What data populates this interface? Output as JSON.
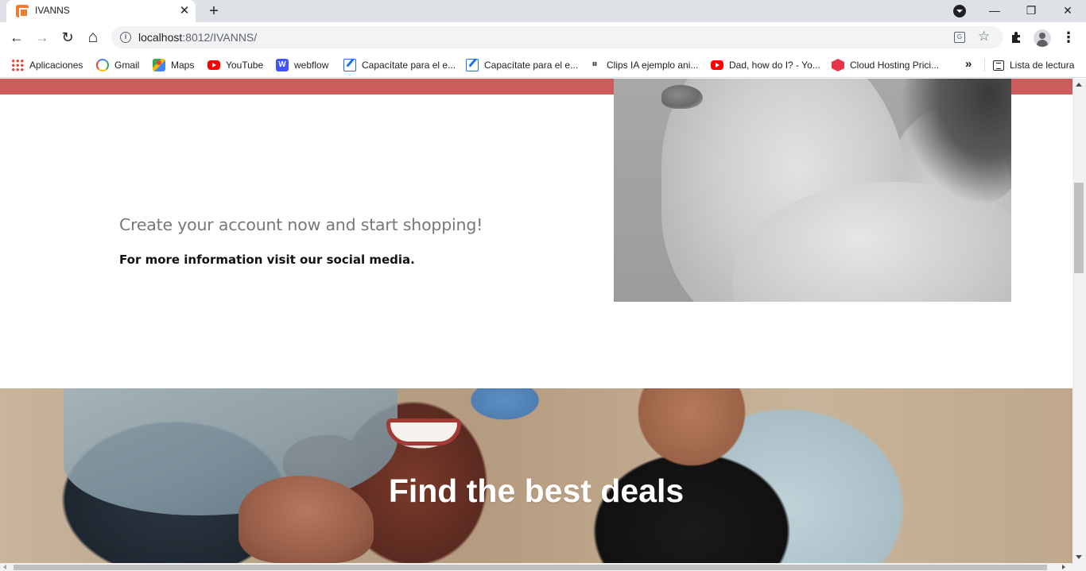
{
  "browser": {
    "tab": {
      "title": "IVANNS",
      "close": "✕"
    },
    "new_tab": "+",
    "window": {
      "minimize": "—",
      "restore": "❐",
      "close": "✕"
    },
    "nav": {
      "back": "←",
      "forward": "→",
      "reload": "↻",
      "home": "⌂"
    },
    "address": {
      "host": "localhost",
      "rest": ":8012/IVANNS/"
    },
    "menu": "⋮",
    "bookmarks": [
      {
        "label": "Aplicaciones",
        "icon": "apps-grid-icon"
      },
      {
        "label": "Gmail",
        "icon": "google-icon"
      },
      {
        "label": "Maps",
        "icon": "maps-icon"
      },
      {
        "label": "YouTube",
        "icon": "youtube-icon"
      },
      {
        "label": "webflow",
        "icon": "webflow-icon"
      },
      {
        "label": "Capacítate para el e...",
        "icon": "edit-icon"
      },
      {
        "label": "Capacítate para el e...",
        "icon": "edit-icon"
      },
      {
        "label": "Clips IA ejemplo ani...",
        "icon": "clips-icon"
      },
      {
        "label": "Dad, how do I? - Yo...",
        "icon": "youtube-icon"
      },
      {
        "label": "Cloud Hosting Prici...",
        "icon": "cloud-hosting-icon"
      }
    ],
    "bookmarks_more": "»",
    "reading_list": "Lista de lectura"
  },
  "page": {
    "cta_title": "Create your account now and start shopping!",
    "cta_subtitle": "For more information visit our social media.",
    "hero_title": "Find the best deals"
  },
  "colors": {
    "accent_band": "#cd5d5d",
    "text_muted": "#777777"
  }
}
